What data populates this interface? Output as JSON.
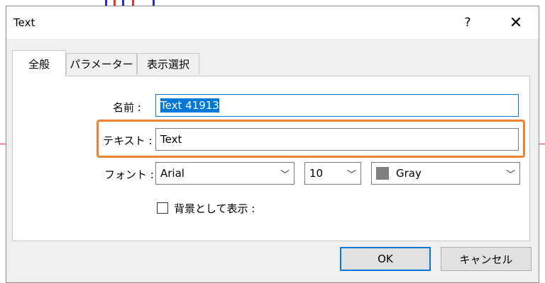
{
  "dialog": {
    "title": "Text",
    "help_label": "?",
    "close_label": "✕"
  },
  "tabs": [
    {
      "label": "全般"
    },
    {
      "label": "パラメーター"
    },
    {
      "label": "表示選択"
    }
  ],
  "form": {
    "name_label": "名前 :",
    "name_value": "Text 41913",
    "text_label": "テキスト :",
    "text_value": "Text",
    "font_label": "フォント :",
    "font_value": "Arial",
    "size_value": "10",
    "color_value": "Gray",
    "color_hex": "#808080",
    "background_label": "背景として表示 :",
    "background_checked": false
  },
  "buttons": {
    "ok_label": "OK",
    "cancel_label": "キャンセル"
  },
  "colors": {
    "highlight": "#ee8133",
    "focus": "#0078d7"
  }
}
